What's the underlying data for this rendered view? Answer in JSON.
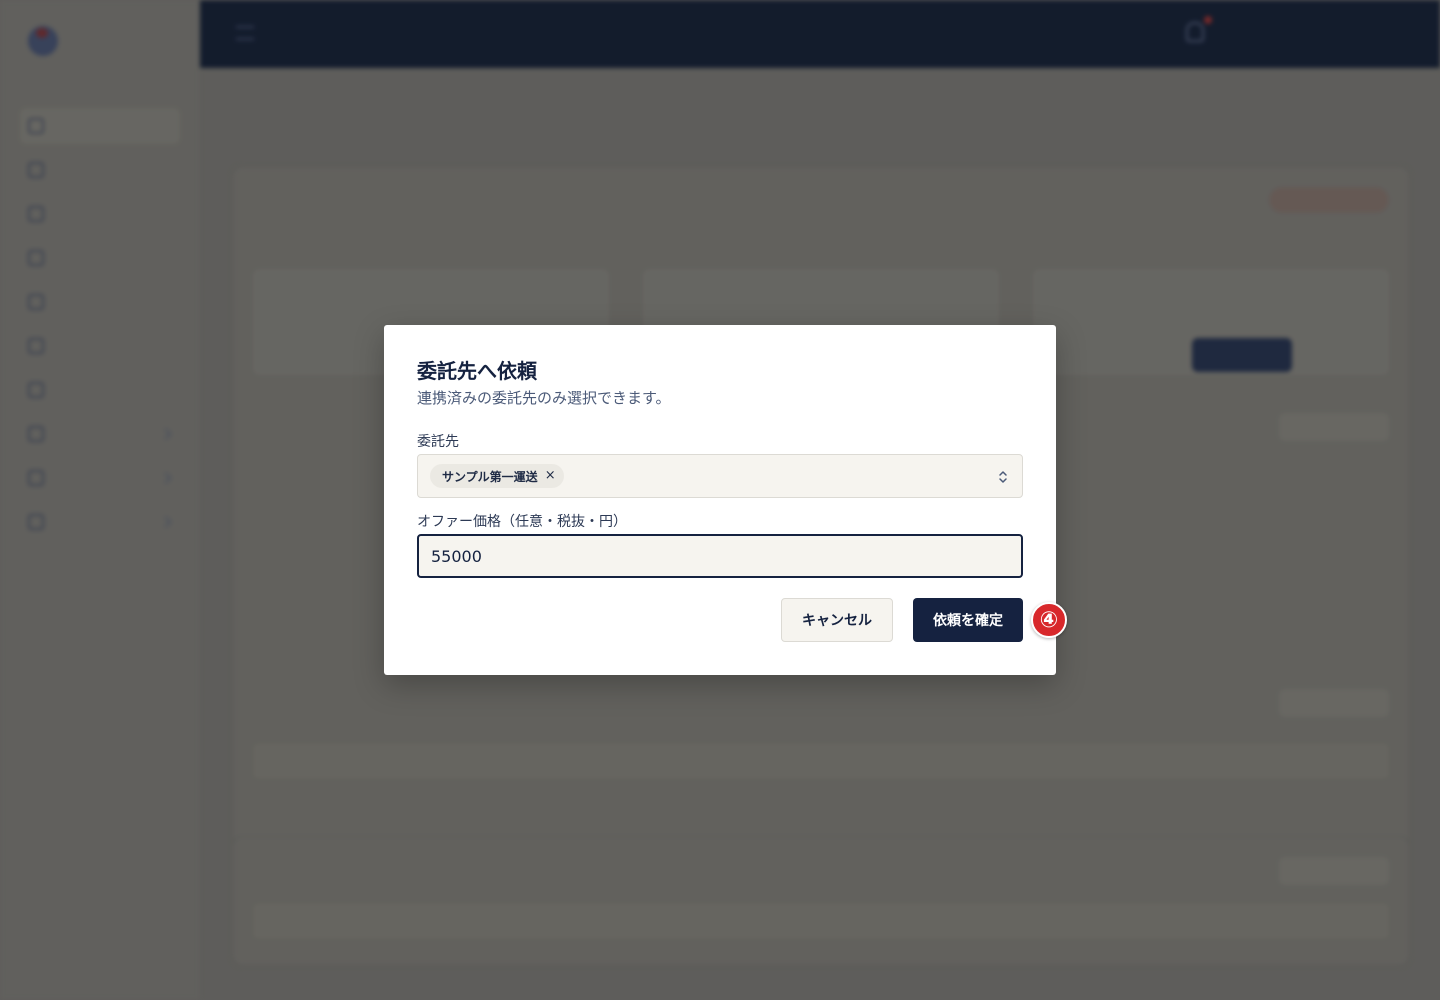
{
  "modal": {
    "title": "委託先へ依頼",
    "description": "連携済みの委託先のみ選択できます。",
    "contractor_label": "委託先",
    "selected_contractor": "サンプル第一運送",
    "chip_remove_glyph": "×",
    "price_label": "オファー価格（任意・税抜・円）",
    "price_value": "55000",
    "cancel_label": "キャンセル",
    "confirm_label": "依頼を確定"
  },
  "annotation": {
    "step_marker": "④",
    "color": "#d8282b"
  },
  "icons": {
    "select_chevron": "chevron-up-down-icon",
    "chip_remove": "close-icon"
  },
  "colors": {
    "primary": "#152240",
    "input_bg": "#f6f4ef",
    "topbar": "#0f1a2e"
  }
}
